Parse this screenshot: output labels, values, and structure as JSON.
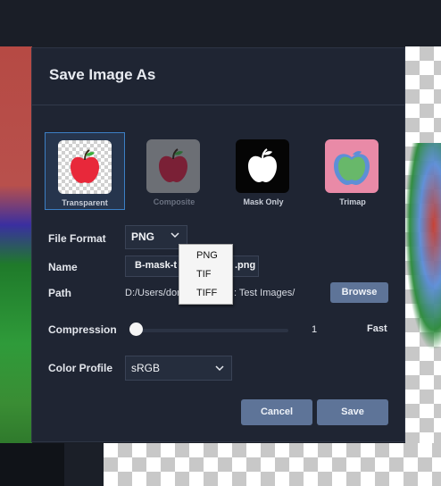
{
  "dialog": {
    "title": "Save Image As"
  },
  "modes": [
    {
      "label": "Transparent",
      "icon": "apple-transparent-icon",
      "selected": true
    },
    {
      "label": "Composite",
      "icon": "apple-composite-icon",
      "selected": false
    },
    {
      "label": "Mask Only",
      "icon": "apple-mask-icon",
      "selected": false
    },
    {
      "label": "Trimap",
      "icon": "apple-trimap-icon",
      "selected": false
    }
  ],
  "fields": {
    "file_format_label": "File Format",
    "file_format_value": "PNG",
    "name_label": "Name",
    "name_value": "B-mask-t",
    "name_suffix": ".png",
    "path_label": "Path",
    "path_prefix": "D:/Users/dor",
    "path_suffix": ": Test Images/",
    "browse_label": "Browse",
    "compression_label": "Compression",
    "compression_value": "1",
    "compression_hint": "Fast",
    "color_profile_label": "Color Profile",
    "color_profile_value": "sRGB"
  },
  "format_dropdown": {
    "options": [
      "PNG",
      "TIF",
      "TIFF"
    ]
  },
  "buttons": {
    "cancel": "Cancel",
    "save": "Save"
  },
  "colors": {
    "dialog_bg": "#1f2533",
    "accent_selected": "#3c7fc4",
    "button": "#5e7498"
  }
}
